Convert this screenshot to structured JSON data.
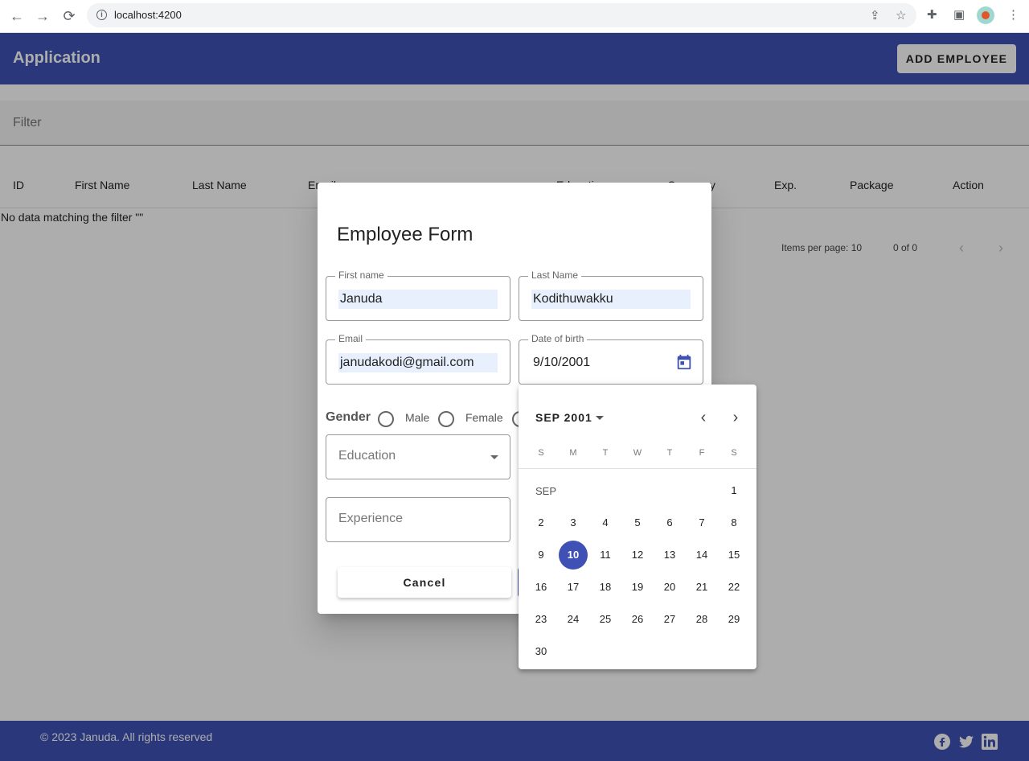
{
  "browser": {
    "url": "localhost:4200"
  },
  "app": {
    "title": "Application",
    "add_button": "ADD EMPLOYEE"
  },
  "filter": {
    "label": "Filter"
  },
  "table": {
    "columns": [
      "ID",
      "First Name",
      "Last Name",
      "Email",
      "",
      "",
      "Education",
      "Company",
      "Exp.",
      "Package",
      "Action"
    ],
    "empty_text": "No data matching the filter \"\""
  },
  "paginator": {
    "items_per_page": "Items per page: 10",
    "range": "0 of 0"
  },
  "footer": {
    "copyright": "© 2023 Januda. All rights reserved"
  },
  "dialog": {
    "title": "Employee Form",
    "first_name": {
      "label": "First name",
      "value": "Januda"
    },
    "last_name": {
      "label": "Last Name",
      "value": "Kodithuwakku"
    },
    "email": {
      "label": "Email",
      "value": "janudakodi@gmail.com"
    },
    "dob": {
      "label": "Date of birth",
      "value": "9/10/2001"
    },
    "gender": {
      "label": "Gender",
      "options": [
        "Male",
        "Female"
      ]
    },
    "education": {
      "placeholder": "Education"
    },
    "experience": {
      "placeholder": "Experience"
    },
    "cancel": "Cancel"
  },
  "datepicker": {
    "period": "SEP 2001",
    "month_label": "SEP",
    "weekdays": [
      "S",
      "M",
      "T",
      "W",
      "T",
      "F",
      "S"
    ],
    "selected_day": 10,
    "first_weekday": 6,
    "days_in_month": 30
  },
  "colors": {
    "primary": "#3f51b5"
  }
}
